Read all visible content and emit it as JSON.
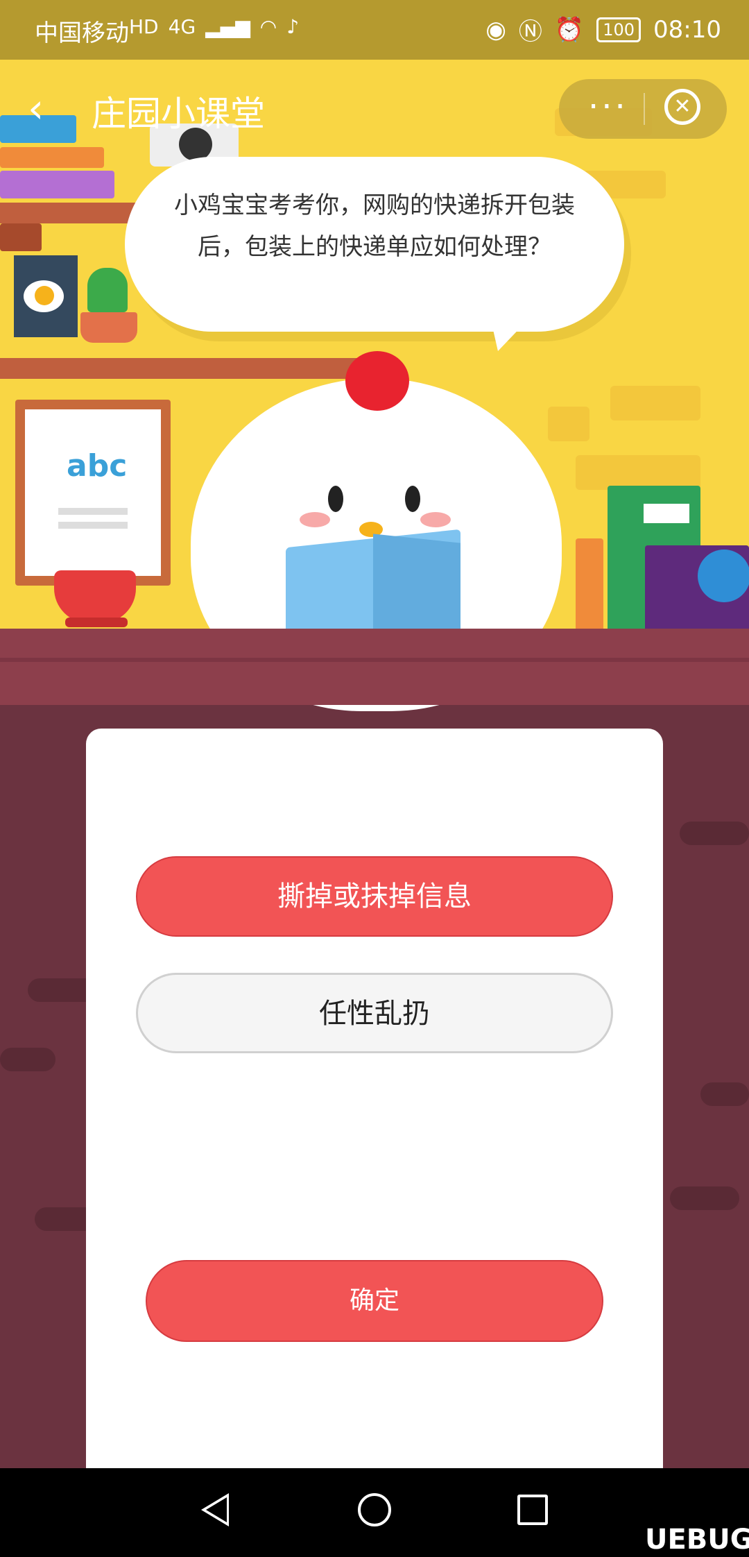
{
  "status_bar": {
    "carrier": "中国移动",
    "hd": "HD",
    "network": "4G",
    "battery": "100",
    "time": "08:10"
  },
  "nav": {
    "title": "庄园小课堂",
    "more": "···"
  },
  "scene": {
    "poster_letters": "abc"
  },
  "quiz": {
    "question": "小鸡宝宝考考你，网购的快递拆开包装后，包装上的快递单应如何处理？",
    "options": [
      "撕掉或抹掉信息",
      "任性乱扔"
    ],
    "confirm": "确定"
  },
  "watermark": "UEBUG"
}
